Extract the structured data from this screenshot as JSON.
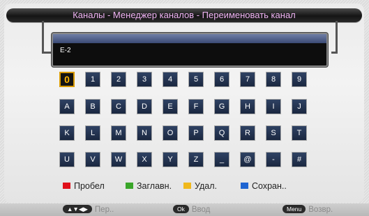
{
  "title": "Каналы - Менеджер каналов - Переименовать канал",
  "channel_name": "E-2",
  "keyboard": {
    "rows": [
      [
        "0",
        "1",
        "2",
        "3",
        "4",
        "5",
        "6",
        "7",
        "8",
        "9"
      ],
      [
        "A",
        "B",
        "C",
        "D",
        "E",
        "F",
        "G",
        "H",
        "I",
        "J"
      ],
      [
        "K",
        "L",
        "M",
        "N",
        "O",
        "P",
        "Q",
        "R",
        "S",
        "T"
      ],
      [
        "U",
        "V",
        "W",
        "X",
        "Y",
        "Z",
        "_",
        "@",
        "-",
        "#"
      ]
    ],
    "selected": "0"
  },
  "legend": [
    {
      "label": "Пробел",
      "color": "#e0101a",
      "icon": "red-key-icon"
    },
    {
      "label": "Заглавн.",
      "color": "#3aa62a",
      "icon": "green-key-icon"
    },
    {
      "label": "Удал.",
      "color": "#f0b81c",
      "icon": "yellow-key-icon"
    },
    {
      "label": "Сохран..",
      "color": "#1e64d2",
      "icon": "blue-key-icon"
    }
  ],
  "hints": [
    {
      "key": "▲▼◀▶",
      "label": "Пер..",
      "icon": "arrows-key-icon"
    },
    {
      "key": "Ok",
      "label": "Ввод",
      "icon": "ok-key-icon"
    },
    {
      "key": "Menu",
      "label": "Возвр.",
      "icon": "menu-key-icon"
    }
  ]
}
